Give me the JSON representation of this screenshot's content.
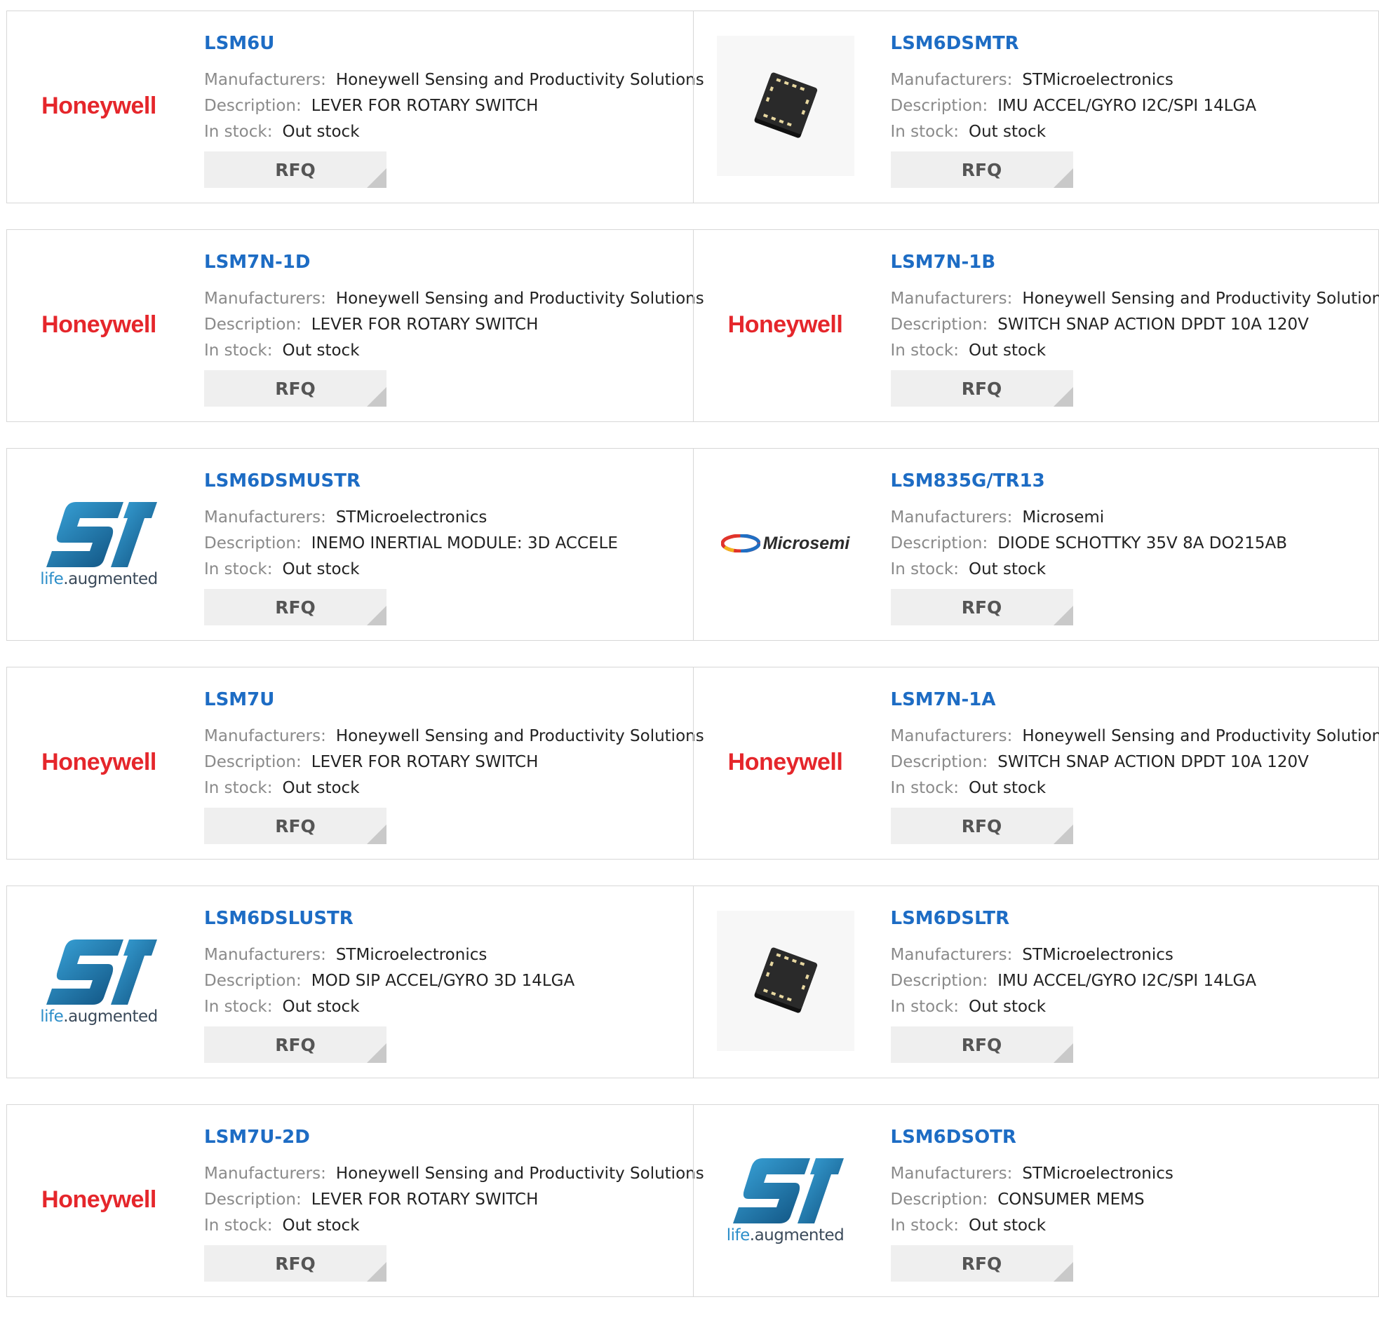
{
  "labels": {
    "manufacturers": "Manufacturers:",
    "description": "Description:",
    "in_stock": "In stock:",
    "rfq": "RFQ"
  },
  "brands": {
    "honeywell": "Honeywell",
    "st_life": "life",
    "st_augmented": ".augmented",
    "microsemi": "Microsemi"
  },
  "colors": {
    "title_blue": "#1d6cc4",
    "honeywell_red": "#e5262b",
    "st_blue": "#2c8ec9",
    "rfq_bg": "#efefef"
  },
  "products": [
    {
      "part": "LSM6U",
      "logo": "honeywell-logo",
      "manufacturer": "Honeywell Sensing and Productivity Solutions",
      "description": "LEVER FOR ROTARY SWITCH",
      "stock": "Out stock"
    },
    {
      "part": "LSM6DSMTR",
      "logo": "chip-image",
      "manufacturer": "STMicroelectronics",
      "description": "IMU ACCEL/GYRO I2C/SPI 14LGA",
      "stock": "Out stock"
    },
    {
      "part": "LSM7N-1D",
      "logo": "honeywell-logo",
      "manufacturer": "Honeywell Sensing and Productivity Solutions",
      "description": "LEVER FOR ROTARY SWITCH",
      "stock": "Out stock"
    },
    {
      "part": "LSM7N-1B",
      "logo": "honeywell-logo",
      "manufacturer": "Honeywell Sensing and Productivity Solutions",
      "description": "SWITCH SNAP ACTION DPDT 10A 120V",
      "stock": "Out stock"
    },
    {
      "part": "LSM6DSMUSTR",
      "logo": "st-logo",
      "manufacturer": "STMicroelectronics",
      "description": "INEMO INERTIAL MODULE: 3D ACCELE",
      "stock": "Out stock"
    },
    {
      "part": "LSM835G/TR13",
      "logo": "microsemi-logo",
      "manufacturer": "Microsemi",
      "description": "DIODE SCHOTTKY 35V 8A DO215AB",
      "stock": "Out stock"
    },
    {
      "part": "LSM7U",
      "logo": "honeywell-logo",
      "manufacturer": "Honeywell Sensing and Productivity Solutions",
      "description": "LEVER FOR ROTARY SWITCH",
      "stock": "Out stock"
    },
    {
      "part": "LSM7N-1A",
      "logo": "honeywell-logo",
      "manufacturer": "Honeywell Sensing and Productivity Solutions",
      "description": "SWITCH SNAP ACTION DPDT 10A 120V",
      "stock": "Out stock"
    },
    {
      "part": "LSM6DSLUSTR",
      "logo": "st-logo",
      "manufacturer": "STMicroelectronics",
      "description": "MOD SIP ACCEL/GYRO 3D 14LGA",
      "stock": "Out stock"
    },
    {
      "part": "LSM6DSLTR",
      "logo": "chip-image",
      "manufacturer": "STMicroelectronics",
      "description": "IMU ACCEL/GYRO I2C/SPI 14LGA",
      "stock": "Out stock"
    },
    {
      "part": "LSM7U-2D",
      "logo": "honeywell-logo",
      "manufacturer": "Honeywell Sensing and Productivity Solutions",
      "description": "LEVER FOR ROTARY SWITCH",
      "stock": "Out stock"
    },
    {
      "part": "LSM6DSOTR",
      "logo": "st-logo",
      "manufacturer": "STMicroelectronics",
      "description": "CONSUMER MEMS",
      "stock": "Out stock"
    }
  ]
}
